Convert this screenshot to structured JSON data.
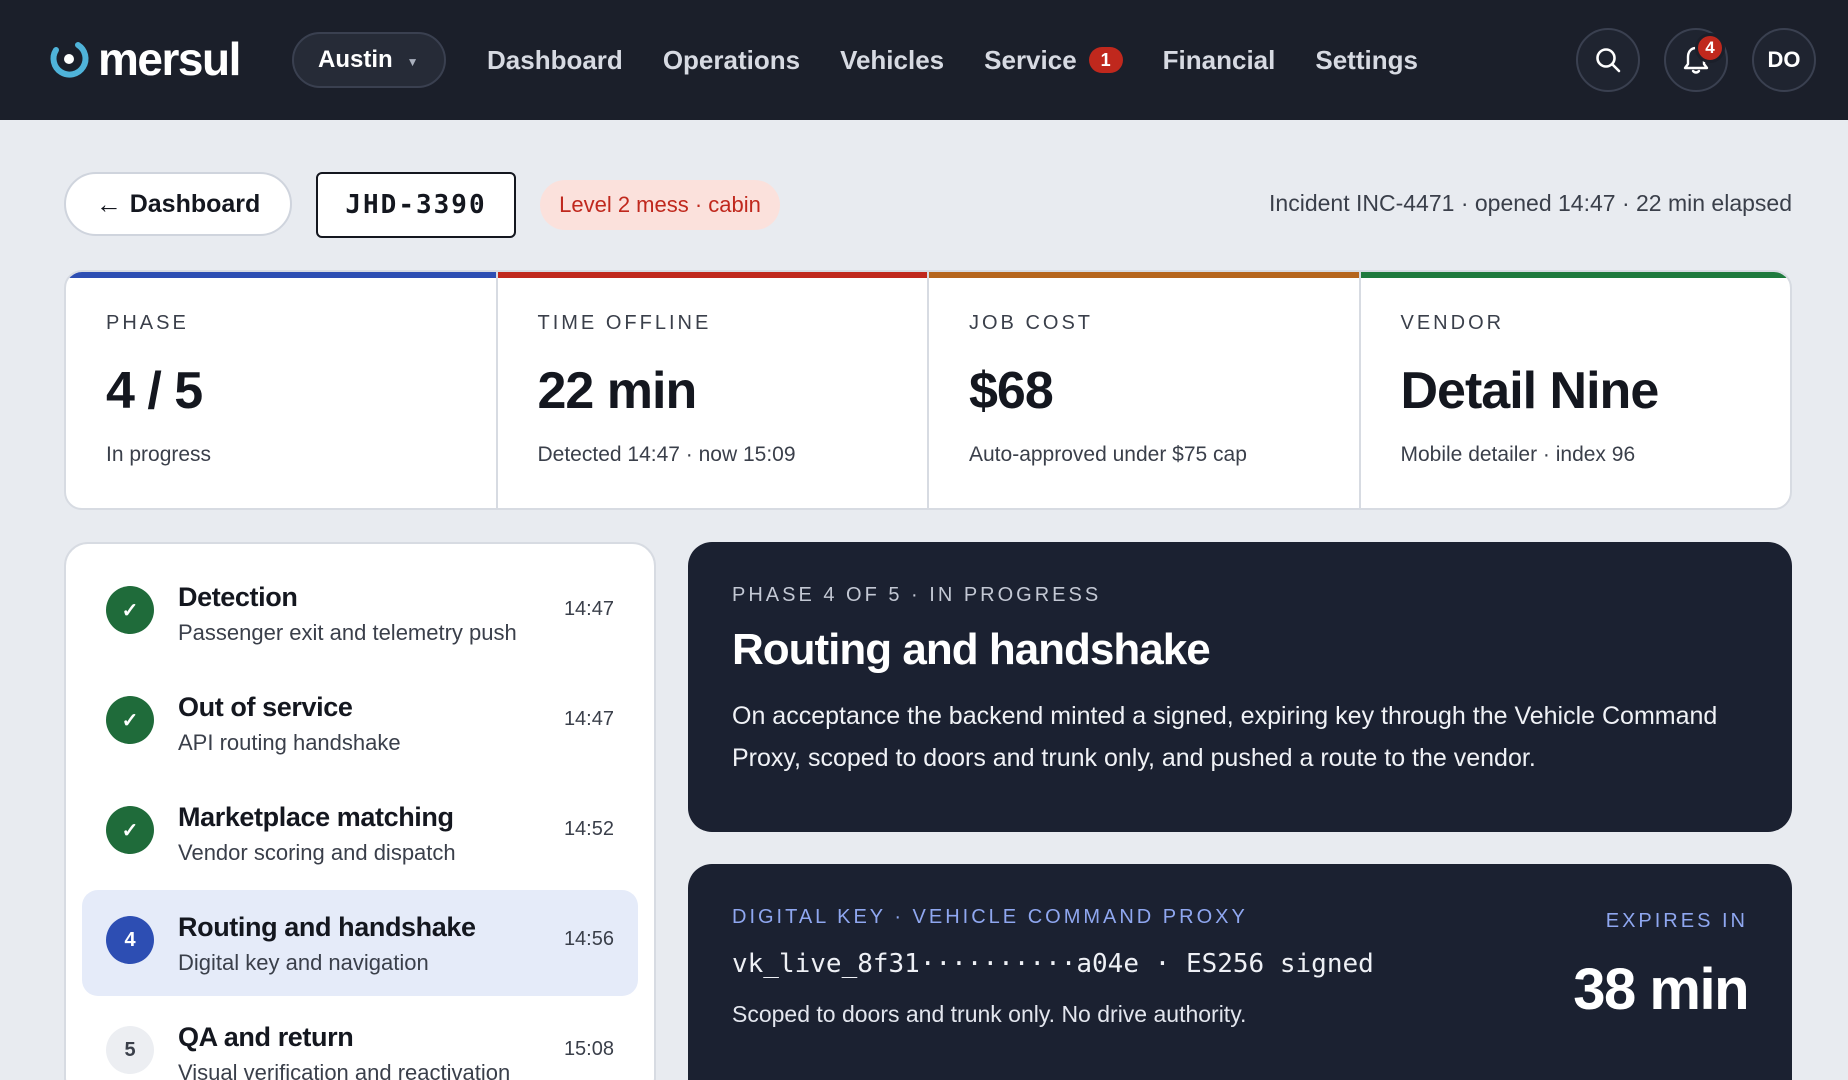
{
  "brand": {
    "name": "mersul",
    "accent": "#4fb3d9"
  },
  "nav": {
    "city": "Austin",
    "items": [
      {
        "label": "Dashboard"
      },
      {
        "label": "Operations"
      },
      {
        "label": "Vehicles"
      },
      {
        "label": "Service",
        "badge": "1"
      },
      {
        "label": "Financial"
      },
      {
        "label": "Settings"
      }
    ],
    "notifications": "4",
    "avatar": "DO"
  },
  "subheader": {
    "back_label": "Dashboard",
    "plate": "JHD-3390",
    "mess_tag": "Level 2 mess · cabin",
    "incident": "Incident INC-4471 · opened 14:47 · 22 min elapsed"
  },
  "stats": [
    {
      "label": "PHASE",
      "value": "4 / 5",
      "sub": "In progress",
      "color": "#2d4eb3"
    },
    {
      "label": "TIME OFFLINE",
      "value": "22 min",
      "sub": "Detected 14:47 · now 15:09",
      "color": "#c0281d"
    },
    {
      "label": "JOB COST",
      "value": "$68",
      "sub": "Auto-approved under $75 cap",
      "color": "#b5651d"
    },
    {
      "label": "VENDOR",
      "value": "Detail Nine",
      "sub": "Mobile detailer · index 96",
      "color": "#1f7a3e"
    }
  ],
  "steps": [
    {
      "status": "done",
      "marker": "✓",
      "title": "Detection",
      "desc": "Passenger exit and telemetry push",
      "time": "14:47"
    },
    {
      "status": "done",
      "marker": "✓",
      "title": "Out of service",
      "desc": "API routing handshake",
      "time": "14:47"
    },
    {
      "status": "done",
      "marker": "✓",
      "title": "Marketplace matching",
      "desc": "Vendor scoring and dispatch",
      "time": "14:52"
    },
    {
      "status": "current",
      "marker": "4",
      "title": "Routing and handshake",
      "desc": "Digital key and navigation",
      "time": "14:56"
    },
    {
      "status": "pending",
      "marker": "5",
      "title": "QA and return",
      "desc": "Visual verification and reactivation",
      "time": "15:08"
    }
  ],
  "phase_card": {
    "eyebrow": "PHASE 4 OF 5 · IN PROGRESS",
    "heading": "Routing and handshake",
    "body": "On acceptance the backend minted a signed, expiring key through the Vehicle Command Proxy, scoped to doors and trunk only, and pushed a route to the vendor."
  },
  "key_card": {
    "eyebrow": "DIGITAL KEY · VEHICLE COMMAND PROXY",
    "key": "vk_live_8f31··········a04e · ES256 signed",
    "note": "Scoped to doors and trunk only. No drive authority.",
    "expires_label": "EXPIRES IN",
    "expires_value": "38 min"
  }
}
